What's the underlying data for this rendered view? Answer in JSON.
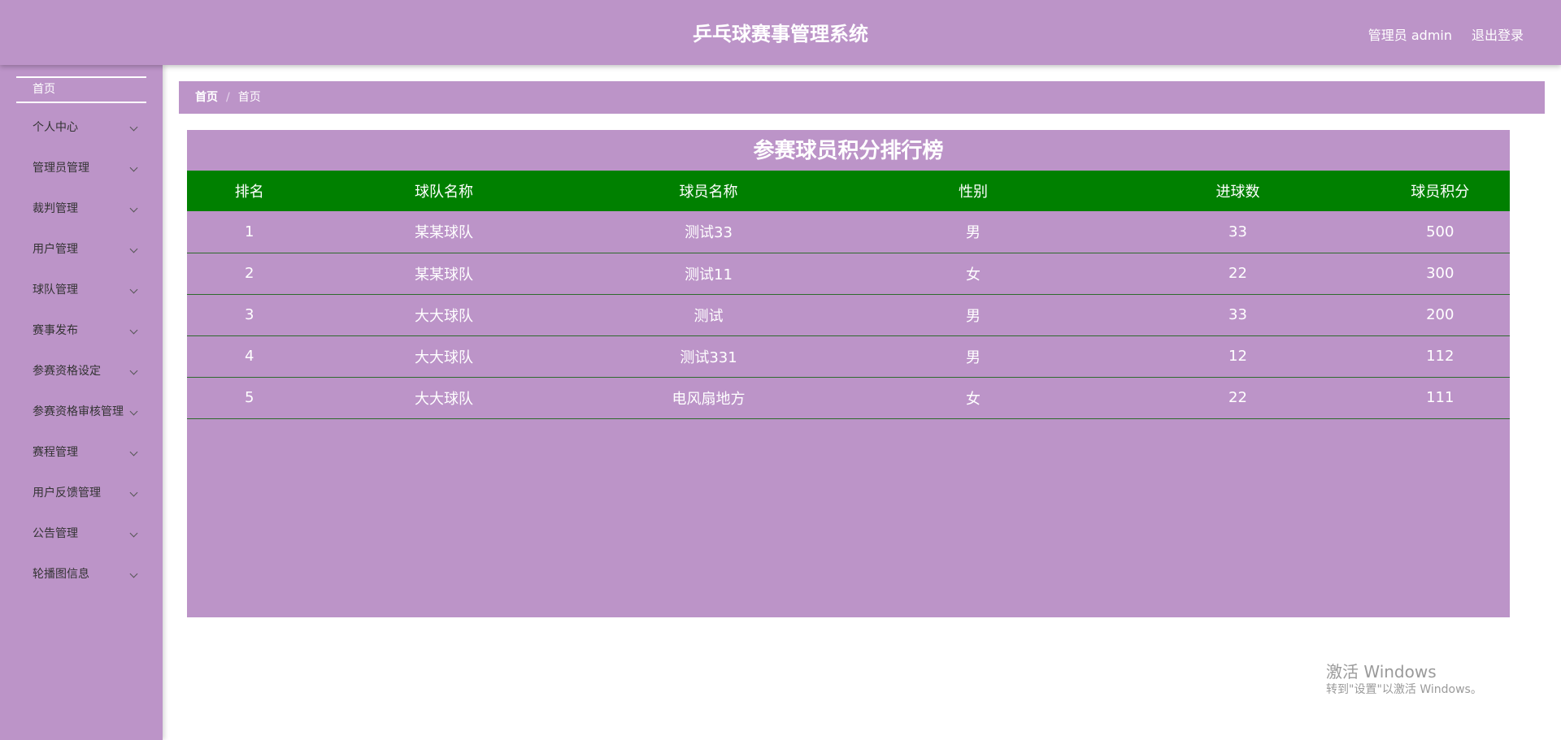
{
  "header": {
    "title": "乒乓球赛事管理系统",
    "user": "管理员 admin",
    "logout": "退出登录"
  },
  "sidebar": {
    "home": "首页",
    "items": [
      {
        "label": "个人中心"
      },
      {
        "label": "管理员管理"
      },
      {
        "label": "裁判管理"
      },
      {
        "label": "用户管理"
      },
      {
        "label": "球队管理"
      },
      {
        "label": "赛事发布"
      },
      {
        "label": "参赛资格设定"
      },
      {
        "label": "参赛资格审核管理"
      },
      {
        "label": "赛程管理"
      },
      {
        "label": "用户反馈管理"
      },
      {
        "label": "公告管理"
      },
      {
        "label": "轮播图信息"
      }
    ]
  },
  "breadcrumb": {
    "home": "首页",
    "separator": "/",
    "current": "首页"
  },
  "board": {
    "title": "参赛球员积分排行榜",
    "columns": [
      "排名",
      "球队名称",
      "球员名称",
      "性别",
      "进球数",
      "球员积分"
    ],
    "rows": [
      [
        "1",
        "某某球队",
        "测试33",
        "男",
        "33",
        "500"
      ],
      [
        "2",
        "某某球队",
        "测试11",
        "女",
        "22",
        "300"
      ],
      [
        "3",
        "大大球队",
        "测试",
        "男",
        "33",
        "200"
      ],
      [
        "4",
        "大大球队",
        "测试331",
        "男",
        "12",
        "112"
      ],
      [
        "5",
        "大大球队",
        "电风扇地方",
        "女",
        "22",
        "111"
      ]
    ]
  },
  "watermark": {
    "line1": "激活 Windows",
    "line2": "转到\"设置\"以激活 Windows。"
  },
  "colors": {
    "theme": "#bc94c8",
    "table_header": "#008000"
  }
}
